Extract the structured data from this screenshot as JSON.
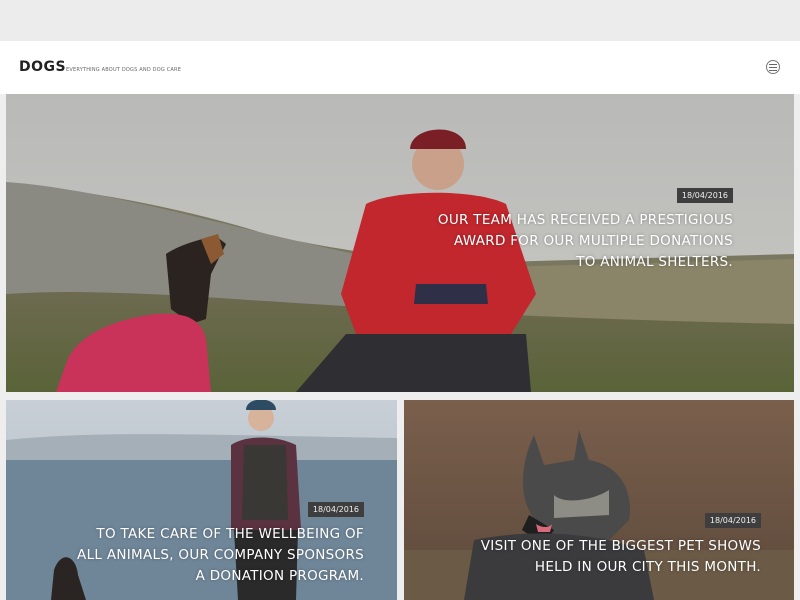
{
  "site": {
    "logo": "DOGS",
    "tagline": "EVERYTHING ABOUT DOGS AND DOG CARE",
    "menu_icon": "hamburger-menu-icon"
  },
  "posts": [
    {
      "date": "18/04/2016",
      "title": "OUR TEAM HAS RECEIVED A PRESTIGIOUS AWARD FOR OUR MULTIPLE DONATIONS TO ANIMAL SHELTERS."
    },
    {
      "date": "18/04/2016",
      "title": "TO TAKE CARE OF THE WELLBEING OF ALL ANIMALS, OUR COMPANY SPONSORS A DONATION PROGRAM."
    },
    {
      "date": "18/04/2016",
      "title": "VISIT ONE OF THE BIGGEST PET SHOWS HELD IN OUR CITY THIS MONTH."
    }
  ],
  "colors": {
    "badge_bg": "#3e3e3e",
    "header_bg": "#ffffff",
    "page_bg": "#eeeeee"
  }
}
